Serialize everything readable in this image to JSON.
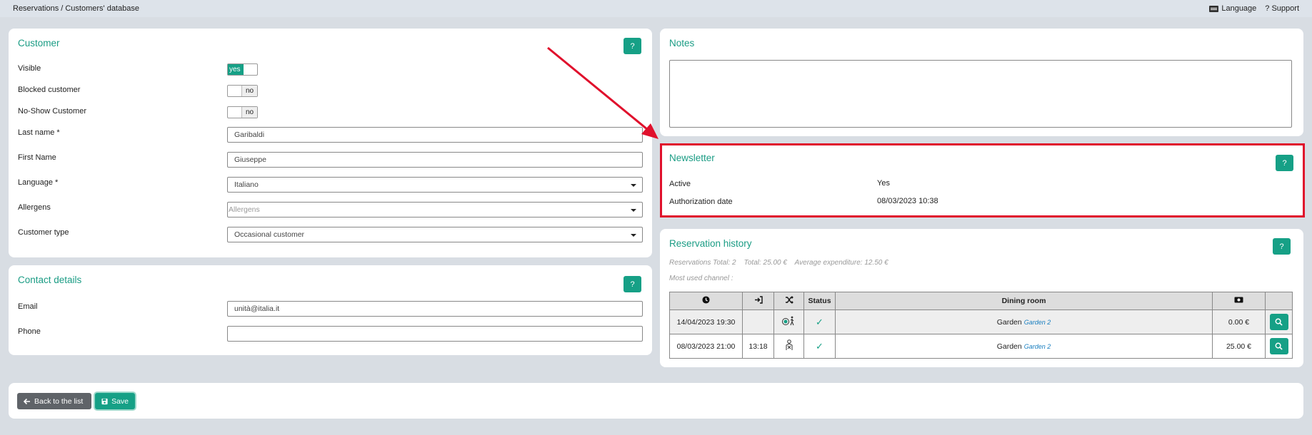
{
  "topbar": {
    "breadcrumb": "Reservations / Customers' database",
    "language_label": "Language",
    "support_label": "? Support"
  },
  "customer": {
    "title": "Customer",
    "help": "?",
    "visible_label": "Visible",
    "visible_value": "yes",
    "blocked_label": "Blocked customer",
    "blocked_value": "no",
    "noshow_label": "No-Show Customer",
    "noshow_value": "no",
    "lastname_label": "Last name  *",
    "lastname_value": "Garibaldi",
    "firstname_label": "First Name",
    "firstname_value": "Giuseppe",
    "language_label": "Language  *",
    "language_value": "Italiano",
    "allergens_label": "Allergens",
    "allergens_placeholder": "Allergens",
    "type_label": "Customer type",
    "type_value": "Occasional customer"
  },
  "contact": {
    "title": "Contact details",
    "help": "?",
    "email_label": "Email",
    "email_value": "unità@italia.it",
    "phone_label": "Phone",
    "phone_value": ""
  },
  "notes": {
    "title": "Notes",
    "value": ""
  },
  "newsletter": {
    "title": "Newsletter",
    "help": "?",
    "active_label": "Active",
    "active_value": "Yes",
    "auth_label": "Authorization date",
    "auth_value": "08/03/2023 10:38"
  },
  "history": {
    "title": "Reservation history",
    "help": "?",
    "stats": "Reservations Total: 2    Total: 25.00 €    Average expenditure: 12.50 €",
    "channel": "Most used channel :",
    "headers": {
      "status": "Status",
      "dining_room": "Dining room"
    },
    "rows": [
      {
        "date": "14/04/2023 19:30",
        "arrival": "",
        "status": "✓",
        "room": "Garden",
        "room_sub": "Garden 2",
        "amount": "0.00 €"
      },
      {
        "date": "08/03/2023 21:00",
        "arrival": "13:18",
        "status": "✓",
        "room": "Garden",
        "room_sub": "Garden 2",
        "amount": "25.00 €"
      }
    ]
  },
  "footer": {
    "back_label": "Back to the list",
    "save_label": "Save"
  },
  "colors": {
    "accent": "#16a086",
    "highlight": "#e0102c"
  }
}
